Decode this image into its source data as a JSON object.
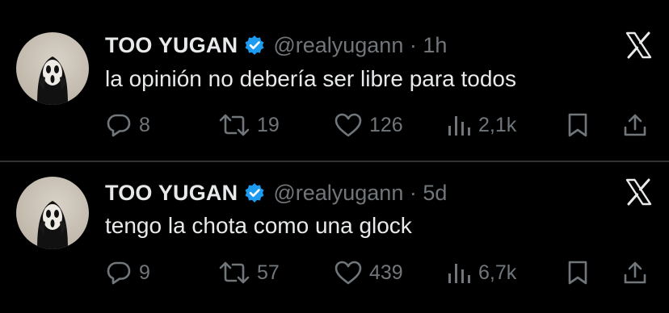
{
  "tweets": [
    {
      "display_name": "TOO YUGAN",
      "handle_time": "@realyugann · 1h",
      "text": "la opinión no debería ser libre para todos",
      "replies": "8",
      "retweets": "19",
      "likes": "126",
      "views": "2,1k"
    },
    {
      "display_name": "TOO YUGAN",
      "handle_time": "@realyugann · 5d",
      "text": "tengo la chota como una glock",
      "replies": "9",
      "retweets": "57",
      "likes": "439",
      "views": "6,7k"
    }
  ],
  "colors": {
    "background": "#000000",
    "text": "#e7e9ea",
    "secondary": "#71767b",
    "verified": "#1d9bf0",
    "divider": "#2f3336"
  },
  "icons": [
    "ghostface-avatar",
    "verified-badge-icon",
    "x-logo-icon",
    "reply-icon",
    "retweet-icon",
    "like-icon",
    "views-icon",
    "bookmark-icon",
    "share-icon"
  ]
}
